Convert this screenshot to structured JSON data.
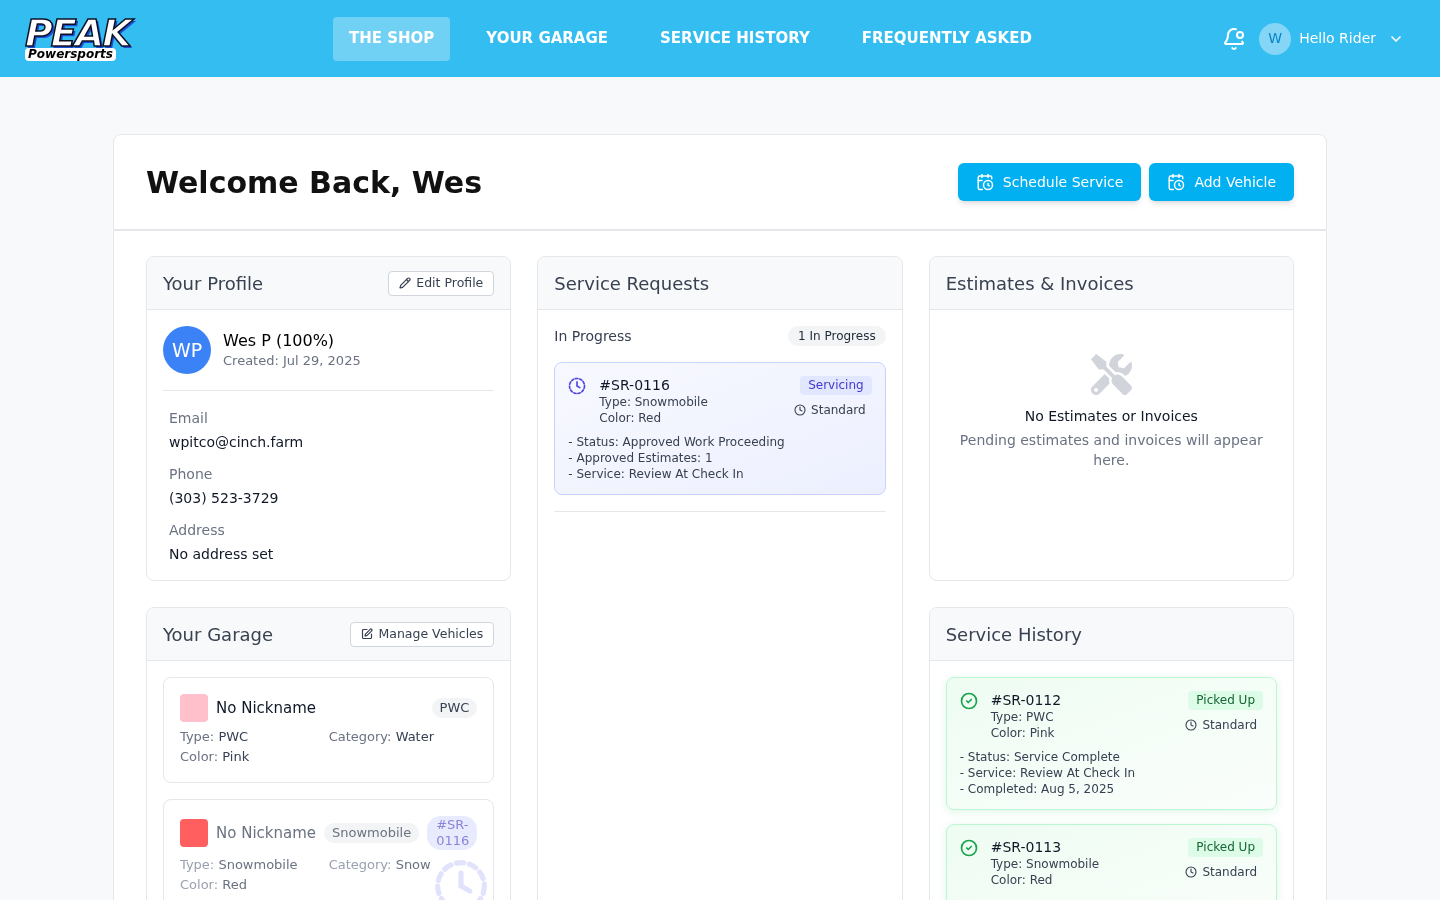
{
  "header": {
    "logo": {
      "wordmark": "PEAK",
      "tagline": "Powersports"
    },
    "nav": [
      {
        "label": "THE SHOP",
        "selected": true
      },
      {
        "label": "YOUR GARAGE",
        "selected": false
      },
      {
        "label": "SERVICE HISTORY",
        "selected": false
      },
      {
        "label": "FREQUENTLY ASKED",
        "selected": false
      }
    ],
    "user": {
      "initial": "W",
      "greeting": "Hello Rider"
    }
  },
  "welcome": {
    "title": "Welcome Back, Wes",
    "actions": [
      "Schedule Service",
      "Add Vehicle"
    ]
  },
  "profile": {
    "title": "Your Profile",
    "edit_button": "Edit Profile",
    "initials": "WP",
    "name": "Wes P (100%)",
    "created": "Created: Jul 29, 2025",
    "fields": [
      {
        "label": "Email",
        "value": "wpitco@cinch.farm"
      },
      {
        "label": "Phone",
        "value": "(303) 523-3729"
      },
      {
        "label": "Address",
        "value": "No address set"
      }
    ]
  },
  "service_requests": {
    "title": "Service Requests",
    "group": {
      "label": "In Progress",
      "count": "1 In Progress"
    },
    "requests": [
      {
        "kind": "in_progress",
        "id": "#SR-0116",
        "type": "Type: Snowmobile",
        "color_text": "Color: Red",
        "status": "Servicing",
        "priority": "Standard",
        "notes": [
          "- Status: Approved Work Proceeding",
          "- Approved Estimates: 1",
          "- Service: Review At Check In"
        ]
      }
    ]
  },
  "estimates": {
    "title": "Estimates & Invoices",
    "empty_title": "No Estimates or Invoices",
    "empty_text": "Pending estimates and invoices will appear here."
  },
  "garage": {
    "title": "Your Garage",
    "manage_button": "Manage Vehicles",
    "vehicles": [
      {
        "name": "No Nickname",
        "color": "#ffc0cb",
        "type_badge": "PWC",
        "in_service": false,
        "details": [
          {
            "label": "Type:",
            "value": "PWC"
          },
          {
            "label": "Category:",
            "value": "Water"
          },
          {
            "label": "Color:",
            "value": "Pink"
          }
        ]
      },
      {
        "name": "No Nickname",
        "color": "#ff5f5f",
        "type_badge": "Snowmobile",
        "in_service": true,
        "service_ref": "#SR-0116",
        "details": [
          {
            "label": "Type:",
            "value": "Snowmobile"
          },
          {
            "label": "Category:",
            "value": "Snow"
          },
          {
            "label": "Color:",
            "value": "Red"
          }
        ]
      }
    ]
  },
  "service_history": {
    "title": "Service History",
    "requests": [
      {
        "kind": "completed",
        "id": "#SR-0112",
        "type": "Type: PWC",
        "color_text": "Color: Pink",
        "status": "Picked Up",
        "priority": "Standard",
        "notes": [
          "- Status: Service Complete",
          "- Service: Review At Check In",
          "- Completed: Aug 5, 2025"
        ]
      },
      {
        "kind": "completed",
        "id": "#SR-0113",
        "type": "Type: Snowmobile",
        "color_text": "Color: Red",
        "status": "Picked Up",
        "priority": "Standard"
      }
    ]
  }
}
